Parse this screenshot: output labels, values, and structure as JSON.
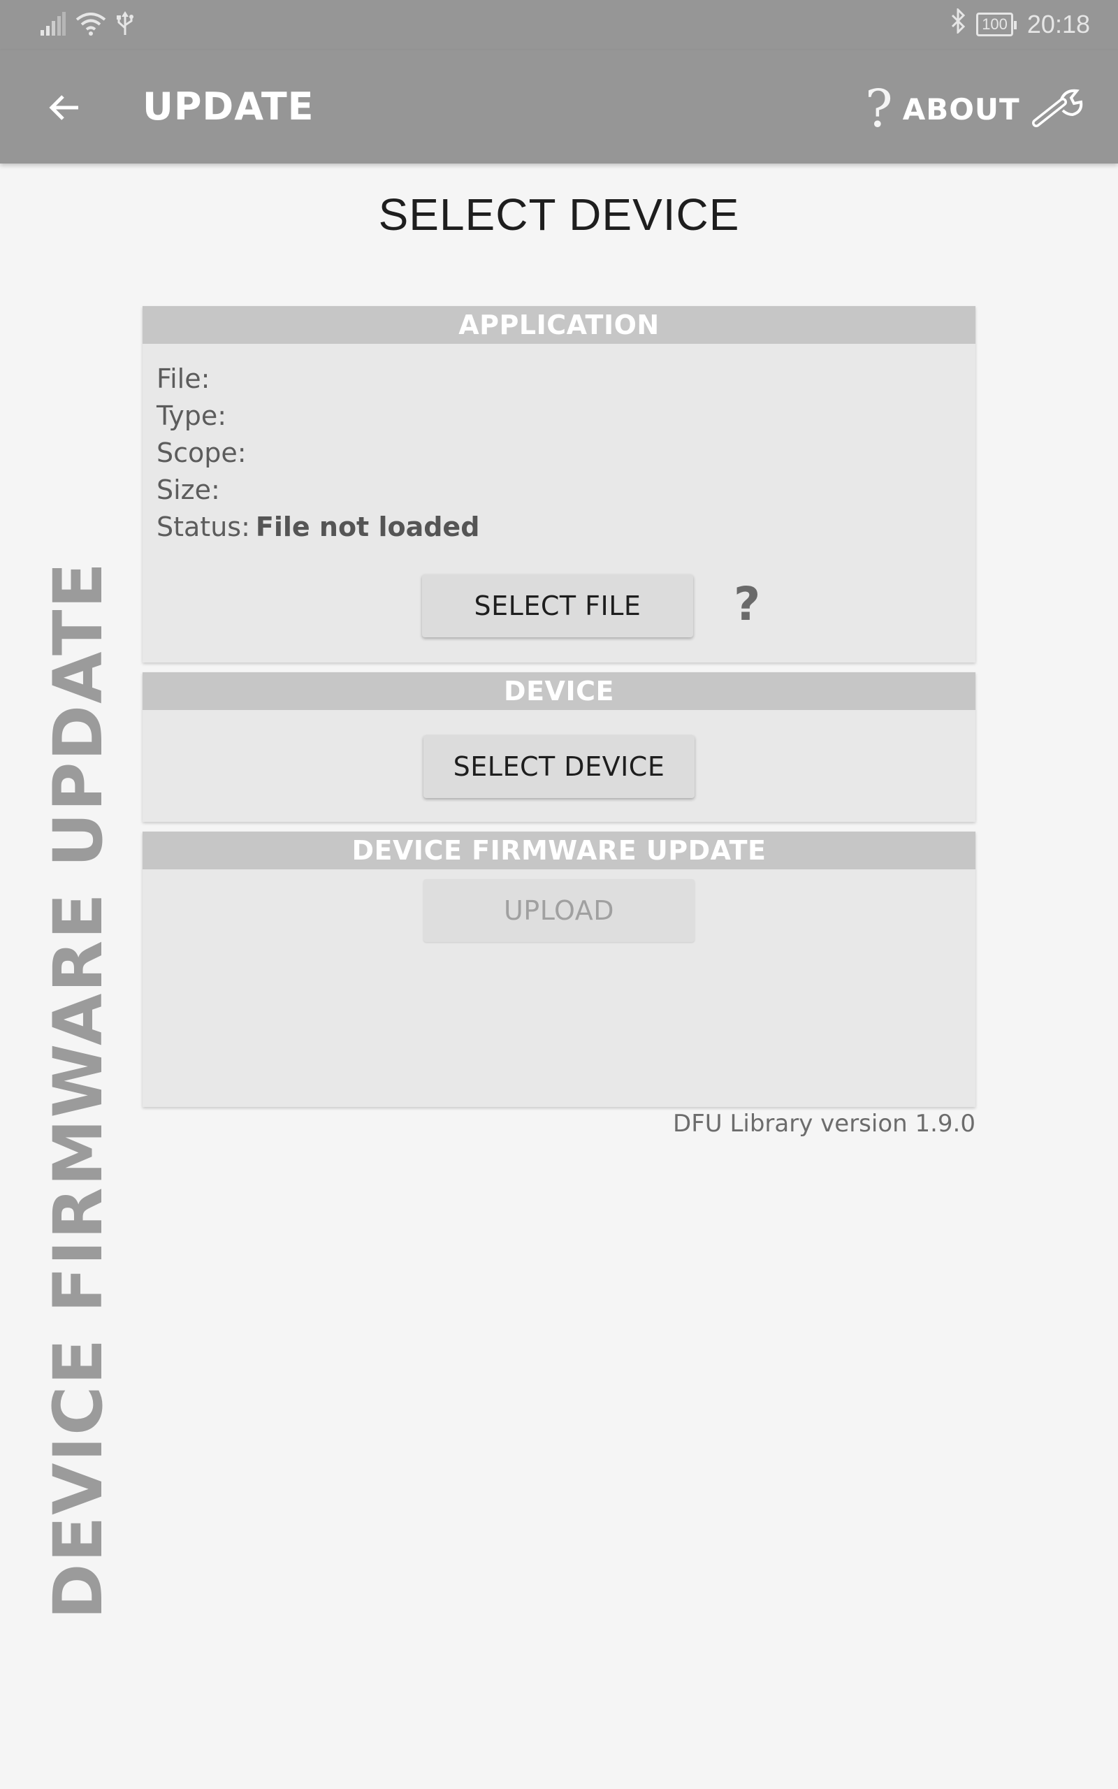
{
  "status_bar": {
    "time": "20:18",
    "battery": "100",
    "icons": [
      "signal-icon",
      "wifi-icon",
      "usb-icon",
      "bluetooth-icon",
      "battery-icon"
    ]
  },
  "toolbar": {
    "title": "UPDATE",
    "about_label": "ABOUT",
    "about_icon": "?",
    "icons": [
      "back-arrow-icon",
      "help-icon",
      "wrench-icon"
    ]
  },
  "page": {
    "heading": "SELECT DEVICE",
    "side_label": "DEVICE FIRMWARE UPDATE",
    "version": "DFU Library version 1.9.0"
  },
  "application": {
    "header": "APPLICATION",
    "file_label": "File:",
    "type_label": "Type:",
    "scope_label": "Scope:",
    "size_label": "Size:",
    "status_label": "Status:",
    "status_value": "File not loaded",
    "select_file_button": "SELECT FILE",
    "help_icon": "?"
  },
  "device": {
    "header": "DEVICE",
    "select_device_button": "SELECT DEVICE"
  },
  "dfu": {
    "header": "DEVICE FIRMWARE UPDATE",
    "upload_button": "UPLOAD"
  },
  "colors": {
    "toolbar": "#969696",
    "background": "#f5f5f5",
    "panel": "#e8e8e8",
    "panel_header": "#c6c6c6",
    "side_label": "#9b9b9b"
  }
}
